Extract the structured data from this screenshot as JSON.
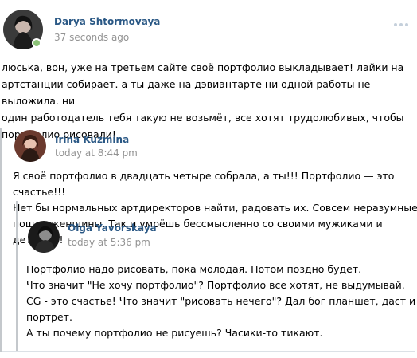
{
  "post": {
    "author": "Darya Shtormovaya",
    "time": "37 seconds ago",
    "online": true,
    "text": "люська, вон, уже на третьем сайте своё портфолио выкладывает! лайки на\nартстанции собирает. а ты даже на дэвиантарте ни одной работы не выложила. ни\nодин работодатель тебя такую не возьмёт, все хотят трудолюбивых, чтобы\nпортфолио рисовали!",
    "more_icon": "more-dots-icon"
  },
  "quote1": {
    "author": "Irina Kuzmina",
    "time": "today at 8:44 pm",
    "text": "Я своё портфолио в двадцать четыре собрала, а ты!!! Портфолио — это счастье!!!\nНет бы нормальных артдиректоров найти, радовать их. Совсем неразумные\nпошли женщины. Так и умрёшь бессмысленно со своими мужиками и детьми!!!"
  },
  "quote2": {
    "author": "Olga Yavorskaya",
    "time": "today at 5:36 pm",
    "text": "Портфолио надо рисовать, пока молодая. Потом поздно будет.\nЧто значит \"Не хочу портфолио\"? Портфолио все хотят, не выдумывай.\nCG - это счастье! Что значит \"рисовать нечего\"? Дал бог планшет, даст и\nпортрет.\nА ты почему портфолио не рисуешь? Часики-то тикают."
  },
  "colors": {
    "author_link": "#2a5885",
    "time_gray": "#939393",
    "quote_border": "#c4c8cc",
    "online": "#8ac176"
  }
}
